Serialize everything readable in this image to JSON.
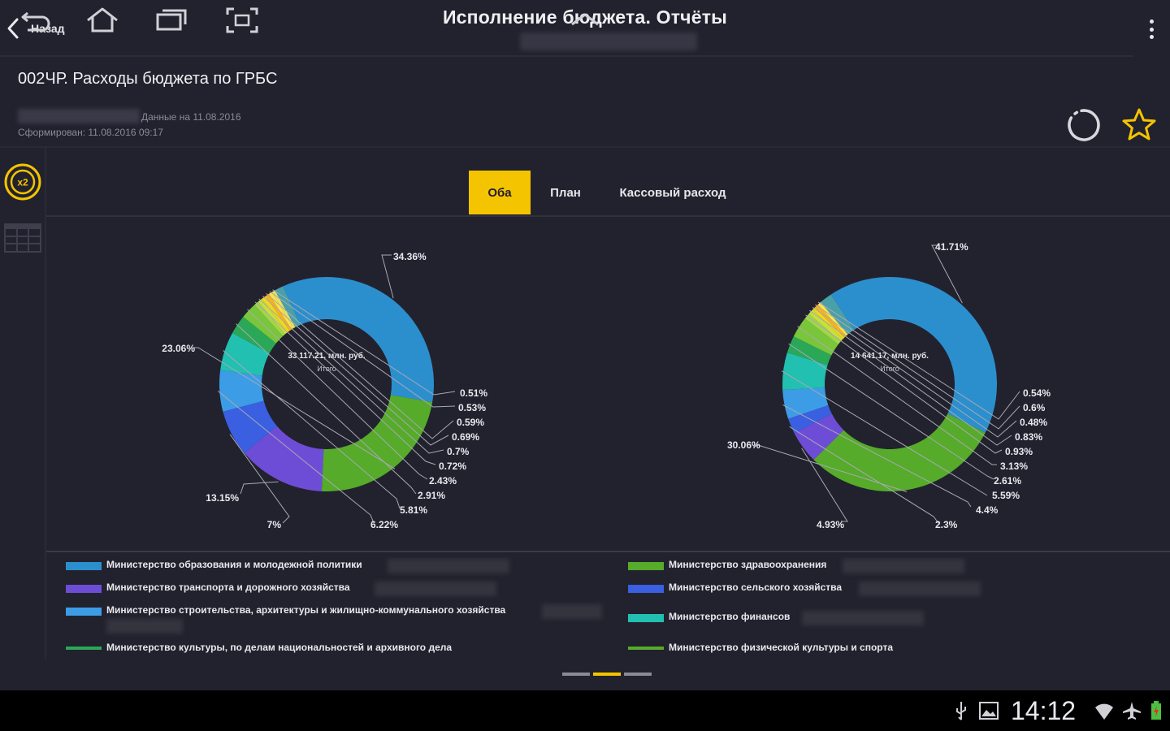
{
  "header": {
    "back_label": "Назад",
    "title": "Исполнение бюджета. Отчёты"
  },
  "report": {
    "title": "002ЧР. Расходы бюджета по ГРБС",
    "data_date": "Данные на 11.08.2016",
    "formed": "Сформирован: 11.08.2016 09:17"
  },
  "tabs": [
    {
      "label": "Оба",
      "active": true
    },
    {
      "label": "План",
      "active": false
    },
    {
      "label": "Кассовый расход",
      "active": false
    }
  ],
  "chart_data": [
    {
      "type": "pie",
      "center_value": "33 117.21, млн. руб.",
      "center_label": "Итого",
      "slices": [
        {
          "name": "Министерство образования и молодежной политики",
          "percent": 34.36,
          "label": "34.36%",
          "color": "#2b8fce"
        },
        {
          "name": "Министерство здравоохранения",
          "percent": 23.06,
          "label": "23.06%",
          "color": "#56ab2a"
        },
        {
          "name": "Министерство транспорта и дорожного хозяйства",
          "percent": 13.15,
          "label": "13.15%",
          "color": "#6e4dd6"
        },
        {
          "name": "Министерство сельского хозяйства",
          "percent": 7,
          "label": "7%",
          "color": "#3a5fe0"
        },
        {
          "name": "Министерство строительства, архитектуры и жилищно-коммунального хозяйства",
          "percent": 6.22,
          "label": "6.22%",
          "color": "#3c9de6"
        },
        {
          "name": "Министерство финансов",
          "percent": 5.81,
          "label": "5.81%",
          "color": "#22c0b0"
        },
        {
          "name": "",
          "percent": 2.91,
          "label": "2.91%",
          "color": "#2aa858"
        },
        {
          "name": "",
          "percent": 2.43,
          "label": "2.43%",
          "color": "#7ac63a"
        },
        {
          "name": "",
          "percent": 0.72,
          "label": "0.72%",
          "color": "#a2d648"
        },
        {
          "name": "",
          "percent": 0.7,
          "label": "0.7%",
          "color": "#c8e03c"
        },
        {
          "name": "",
          "percent": 0.69,
          "label": "0.69%",
          "color": "#f0d81e"
        },
        {
          "name": "",
          "percent": 0.59,
          "label": "0.59%",
          "color": "#f8b21a"
        },
        {
          "name": "",
          "percent": 0.53,
          "label": "0.53%",
          "color": "#fae44a"
        },
        {
          "name": "",
          "percent": 0.51,
          "label": "0.51%",
          "color": "#e8e060"
        },
        {
          "name": "",
          "percent": 1.32,
          "label": "",
          "color": "#4aa0a8"
        }
      ]
    },
    {
      "type": "pie",
      "center_value": "14 641.17, млн. руб.",
      "center_label": "Итого",
      "slices": [
        {
          "name": "Министерство образования и молодежной политики",
          "percent": 41.71,
          "label": "41.71%",
          "color": "#2b8fce"
        },
        {
          "name": "Министерство здравоохранения",
          "percent": 30.06,
          "label": "30.06%",
          "color": "#56ab2a"
        },
        {
          "name": "Министерство транспорта и дорожного хозяйства",
          "percent": 4.93,
          "label": "4.93%",
          "color": "#6e4dd6"
        },
        {
          "name": "Министерство сельского хозяйства",
          "percent": 2.3,
          "label": "2.3%",
          "color": "#3a5fe0"
        },
        {
          "name": "Министерство строительства, архитектуры и жилищно-коммунального хозяйства",
          "percent": 4.4,
          "label": "4.4%",
          "color": "#3c9de6"
        },
        {
          "name": "Министерство финансов",
          "percent": 5.59,
          "label": "5.59%",
          "color": "#22c0b0"
        },
        {
          "name": "",
          "percent": 2.61,
          "label": "2.61%",
          "color": "#2aa858"
        },
        {
          "name": "",
          "percent": 3.13,
          "label": "3.13%",
          "color": "#7ac63a"
        },
        {
          "name": "",
          "percent": 0.93,
          "label": "0.93%",
          "color": "#a2d648"
        },
        {
          "name": "",
          "percent": 0.83,
          "label": "0.83%",
          "color": "#c8e03c"
        },
        {
          "name": "",
          "percent": 0.48,
          "label": "0.48%",
          "color": "#f0d81e"
        },
        {
          "name": "",
          "percent": 0.6,
          "label": "0.6%",
          "color": "#f8b21a"
        },
        {
          "name": "",
          "percent": 0.54,
          "label": "0.54%",
          "color": "#fae44a"
        },
        {
          "name": "",
          "percent": 1.9,
          "label": "",
          "color": "#4aa0a8"
        }
      ]
    }
  ],
  "legend": [
    {
      "label": "Министерство образования и молодежной политики",
      "color": "#2b8fce"
    },
    {
      "label": "Министерство здравоохранения",
      "color": "#56ab2a"
    },
    {
      "label": "Министерство транспорта и дорожного хозяйства",
      "color": "#6e4dd6"
    },
    {
      "label": "Министерство сельского хозяйства",
      "color": "#3a5fe0"
    },
    {
      "label": "Министерство строительства, архитектуры и жилищно-коммунального хозяйства",
      "color": "#3c9de6"
    },
    {
      "label": "Министерство финансов",
      "color": "#22c0b0"
    },
    {
      "label": "Министерство культуры, по делам национальностей и архивного дела",
      "color": "#2aa858"
    },
    {
      "label": "Министерство физической культуры и спорта",
      "color": "#56ab2a"
    }
  ],
  "status_bar": {
    "time": "14:12"
  },
  "colors": {
    "accent": "#f5c400",
    "background": "#22222e"
  }
}
